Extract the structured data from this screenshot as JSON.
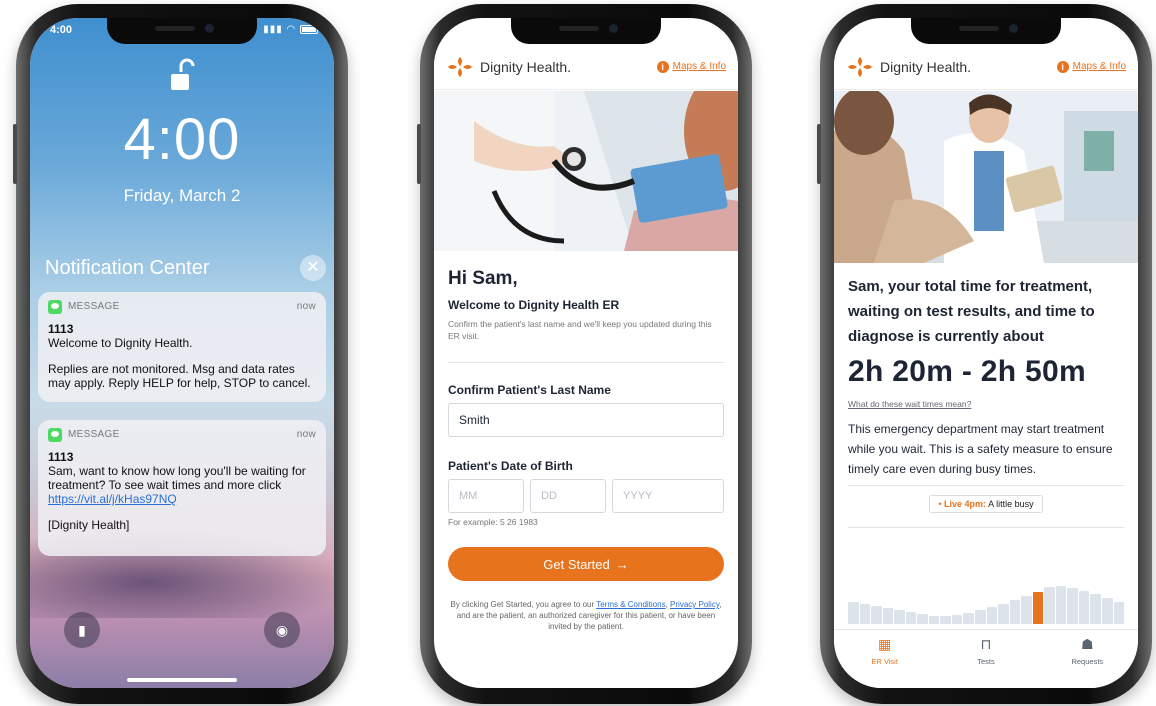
{
  "lock": {
    "status_time": "4:00",
    "big_time": "4:00",
    "date": "Friday, March 2",
    "notification_center": "Notification Center",
    "notifications": [
      {
        "app": "MESSAGE",
        "when": "now",
        "sender": "1113",
        "line1": "Welcome to Dignity Health.",
        "line2": "Replies are not monitored. Msg and data rates may apply. Reply HELP for help, STOP to cancel."
      },
      {
        "app": "MESSAGE",
        "when": "now",
        "sender": "1113",
        "line1": "Sam, want to know how long you'll be waiting for treatment? To see wait times and more click",
        "link": "https://vit.al/j/kHas97NQ",
        "footer": "[Dignity Health]"
      }
    ]
  },
  "brand": {
    "name": "Dignity Health.",
    "maps": "Maps & Info",
    "accent": "#e8731d"
  },
  "signup": {
    "greeting": "Hi Sam,",
    "welcome": "Welcome to Dignity Health ER",
    "copy": "Confirm the patient's last name and we'll keep you updated during this ER visit.",
    "last_name_label": "Confirm Patient's Last Name",
    "last_name_value": "Smith",
    "dob_label": "Patient's Date of Birth",
    "dob_placeholders": {
      "month": "MM",
      "day": "DD",
      "year": "YYYY"
    },
    "dob_hint": "For example: 5 26 1983",
    "cta": "Get Started",
    "legal": {
      "pre": "By clicking Get Started, you agree to our ",
      "terms": "Terms & Conditions",
      "comma": ",",
      "privacy": "Privacy Policy",
      "post": ", and are the patient, an authorized caregiver for this patient, or have been invited by the patient."
    }
  },
  "wait": {
    "headline": "Sam, your total time for treatment, waiting on test results, and time to diagnose is currently about",
    "range": "2h 20m - 2h 50m",
    "link": "What do these wait times mean?",
    "body": "This emergency department may start treatment while you wait. This is a safety measure to ensure timely care even during busy times.",
    "live_label": "Live 4pm:",
    "live_status": "A little busy",
    "busyness": [
      0.55,
      0.5,
      0.45,
      0.4,
      0.35,
      0.3,
      0.25,
      0.2,
      0.2,
      0.22,
      0.28,
      0.35,
      0.42,
      0.5,
      0.6,
      0.7,
      0.8,
      0.92,
      0.95,
      0.9,
      0.82,
      0.75,
      0.65,
      0.55
    ],
    "current_index": 16,
    "tabs": [
      {
        "label": "ER Visit",
        "icon": "calendar-icon"
      },
      {
        "label": "Tests",
        "icon": "test-tube-icon"
      },
      {
        "label": "Requests",
        "icon": "requests-icon"
      }
    ]
  }
}
